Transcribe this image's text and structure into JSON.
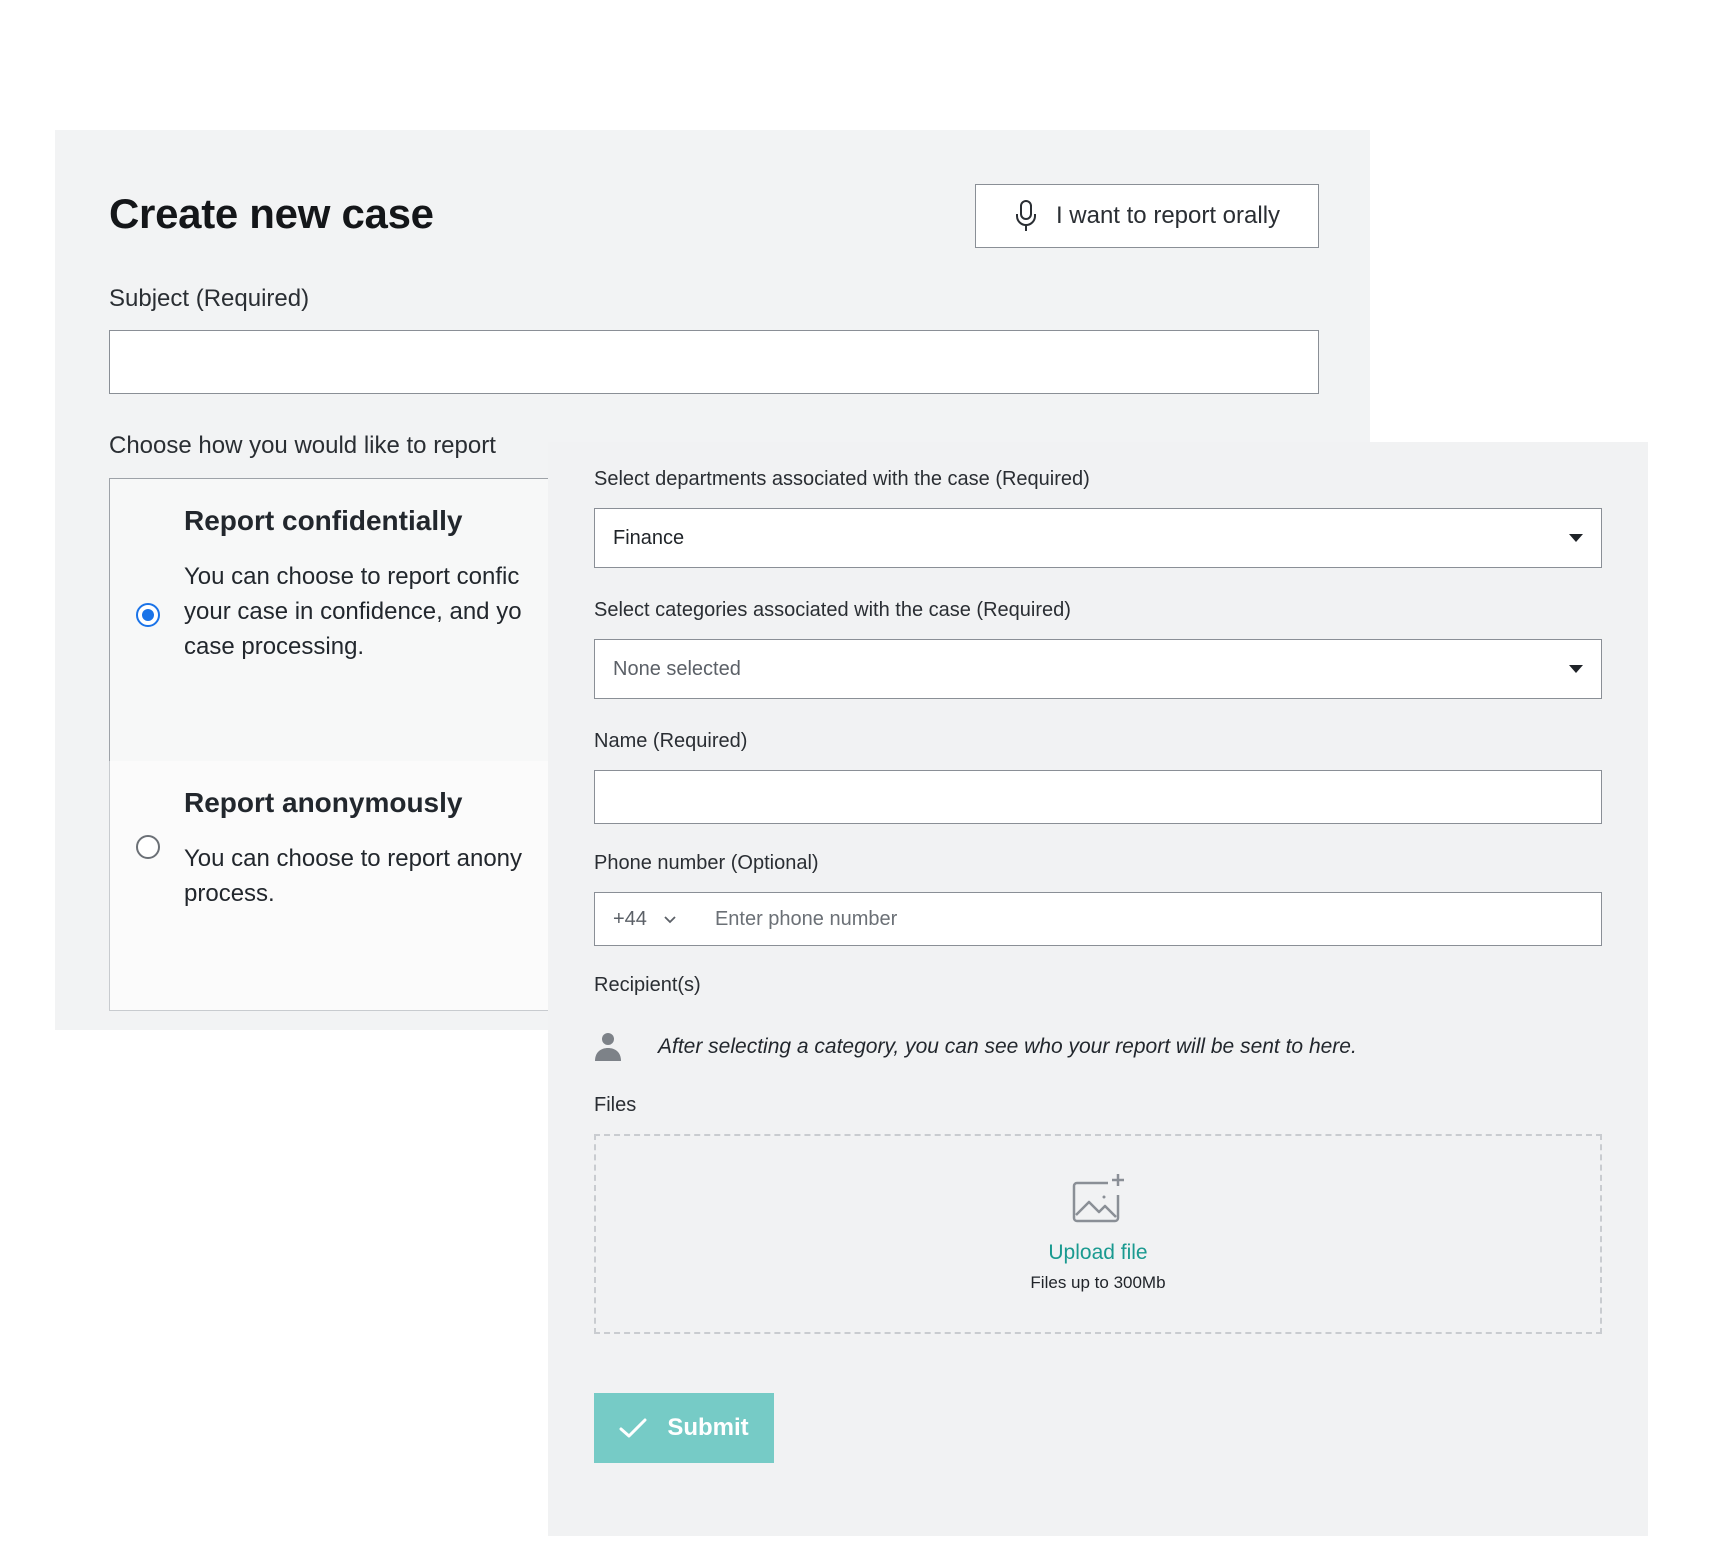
{
  "header": {
    "title": "Create new case",
    "oral_button_label": "I want to report orally"
  },
  "subject": {
    "label": "Subject (Required)",
    "value": ""
  },
  "report_mode": {
    "label": "Choose how you would like to report",
    "options": [
      {
        "title": "Report confidentially",
        "description": "You can choose to report confi your case in confidence, and yo case processing.",
        "lines": [
          "You can choose to report confic",
          "your case in confidence, and yo",
          "case processing."
        ],
        "selected": true
      },
      {
        "title": "Report anonymously",
        "lines": [
          "You can choose to report anony",
          "process."
        ],
        "selected": false
      }
    ]
  },
  "form": {
    "departments": {
      "label": "Select departments associated with the case (Required)",
      "value": "Finance"
    },
    "categories": {
      "label": "Select categories associated with the case (Required)",
      "value": "None selected"
    },
    "name": {
      "label": "Name (Required)",
      "value": ""
    },
    "phone": {
      "label": "Phone number (Optional)",
      "country_code": "+44",
      "placeholder": "Enter phone number"
    },
    "recipients": {
      "label": "Recipient(s)",
      "hint": "After selecting a category, you can see who your report will be sent to here."
    },
    "files": {
      "label": "Files",
      "upload_label": "Upload file",
      "hint": "Files up to 300Mb"
    },
    "submit_label": "Submit"
  },
  "colors": {
    "accent": "#1a73e8",
    "teal_link": "#1a9a90",
    "submit_bg": "#76cbc6",
    "panel_bg": "#f2f3f4"
  },
  "icons": {
    "oral": "microphone-icon",
    "dropdown": "caret-down-icon",
    "phone_code": "chevron-down-icon",
    "recipient": "person-icon",
    "upload": "image-add-icon",
    "submit": "checkmark-icon"
  }
}
